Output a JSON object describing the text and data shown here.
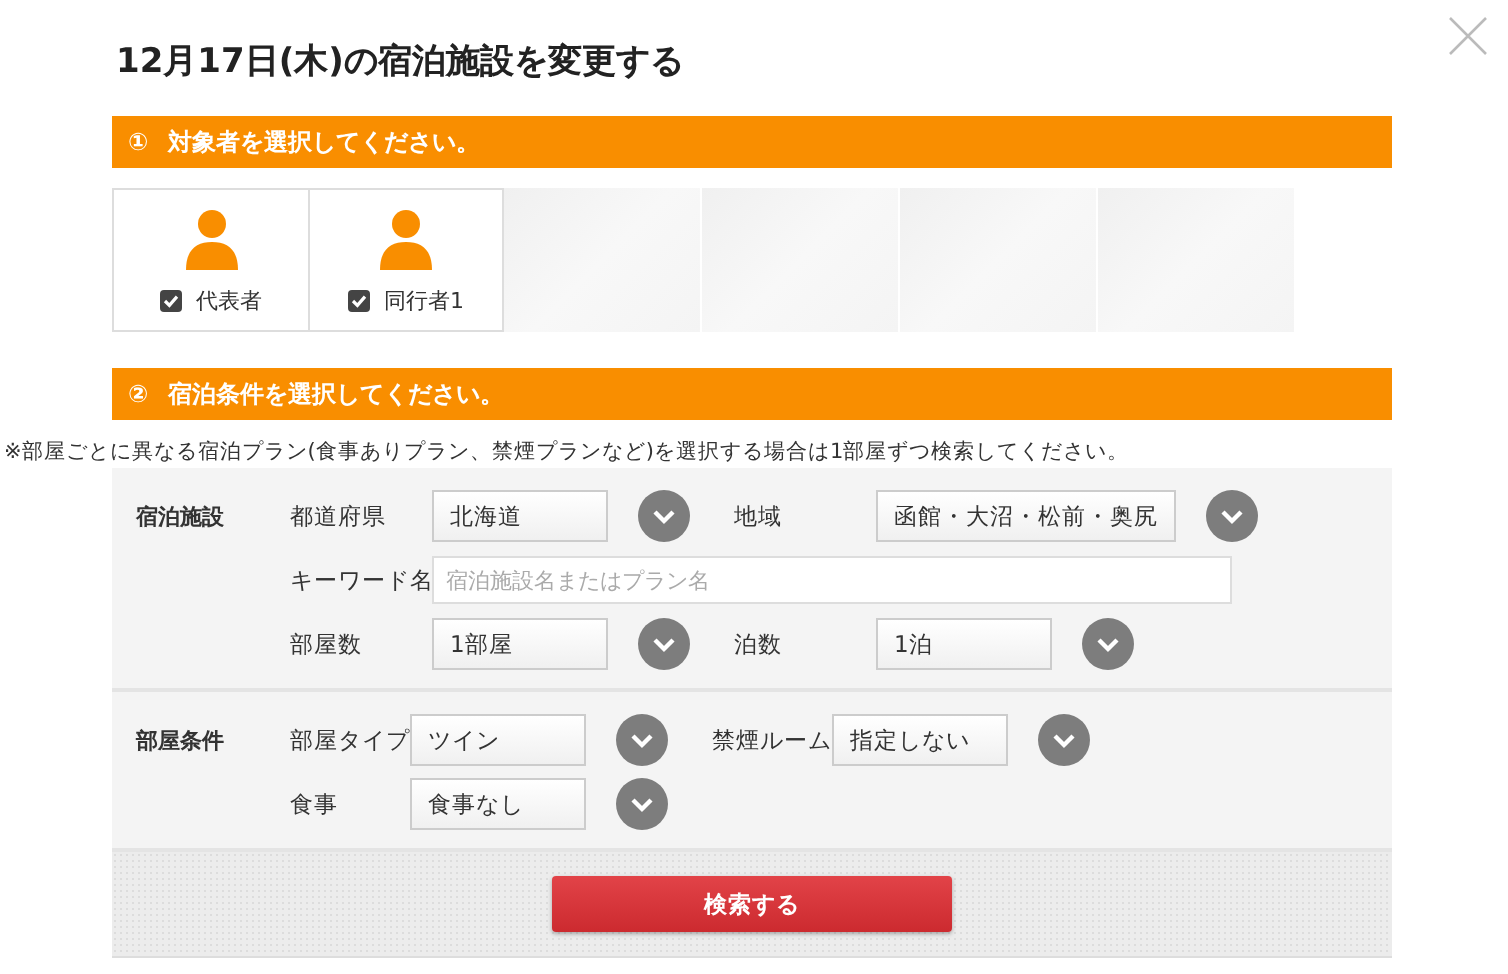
{
  "title": "12月17日(木)の宿泊施設を変更する",
  "step1": {
    "number": "①",
    "label": "対象者を選択してください。"
  },
  "guests": [
    {
      "kind": "guest",
      "label": "代表者",
      "checked": true
    },
    {
      "kind": "guest",
      "label": "同行者1",
      "checked": true
    },
    {
      "kind": "empty"
    },
    {
      "kind": "empty"
    },
    {
      "kind": "empty"
    },
    {
      "kind": "empty"
    }
  ],
  "step2": {
    "number": "②",
    "label": "宿泊条件を選択してください。"
  },
  "note": "※部屋ごとに異なる宿泊プラン(食事ありプラン、禁煙プランなど)を選択する場合は1部屋ずつ検索してください。",
  "sections": [
    {
      "heading": "宿泊施設",
      "rows": [
        [
          {
            "kind": "select",
            "label": "都道府県",
            "value": "北海道"
          },
          {
            "kind": "select",
            "label": "地域",
            "value": "函館・大沼・松前・奥尻"
          }
        ],
        [
          {
            "kind": "text",
            "label": "キーワード名",
            "placeholder": "宿泊施設名またはプラン名"
          }
        ],
        [
          {
            "kind": "select",
            "label": "部屋数",
            "value": "1部屋"
          },
          {
            "kind": "select",
            "label": "泊数",
            "value": "1泊"
          }
        ]
      ]
    },
    {
      "heading": "部屋条件",
      "rows": [
        [
          {
            "kind": "select",
            "label": "部屋タイプ",
            "value": "ツイン"
          },
          {
            "kind": "select",
            "label": "禁煙ルーム",
            "value": "指定しない"
          }
        ],
        [
          {
            "kind": "select",
            "label": "食事",
            "value": "食事なし"
          }
        ]
      ]
    }
  ],
  "search_button": "検索する"
}
